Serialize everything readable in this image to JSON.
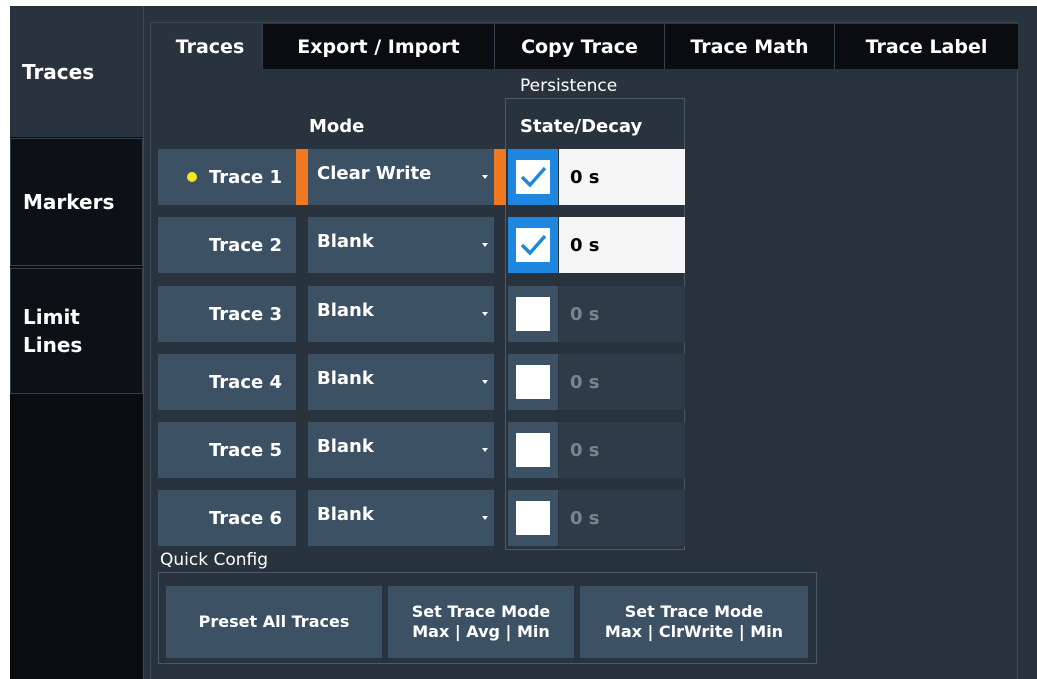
{
  "side_tabs": [
    {
      "label_lines": [
        "Traces"
      ],
      "active": true
    },
    {
      "label_lines": [
        "Markers"
      ],
      "active": false
    },
    {
      "label_lines": [
        "Limit",
        "Lines"
      ],
      "active": false
    }
  ],
  "top_tabs": [
    {
      "label": "Traces",
      "active": true
    },
    {
      "label": "Export / Import",
      "active": false
    },
    {
      "label": "Copy Trace",
      "active": false
    },
    {
      "label": "Trace Math",
      "active": false
    },
    {
      "label": "Trace Label",
      "active": false
    }
  ],
  "headers": {
    "persistence": "Persistence",
    "mode": "Mode",
    "state_decay": "State/Decay"
  },
  "traces": [
    {
      "name": "Trace 1",
      "mode": "Clear Write",
      "state": true,
      "decay": "0 s",
      "selected": true
    },
    {
      "name": "Trace 2",
      "mode": "Blank",
      "state": true,
      "decay": "0 s",
      "selected": false
    },
    {
      "name": "Trace 3",
      "mode": "Blank",
      "state": false,
      "decay": "0 s",
      "selected": false
    },
    {
      "name": "Trace 4",
      "mode": "Blank",
      "state": false,
      "decay": "0 s",
      "selected": false
    },
    {
      "name": "Trace 5",
      "mode": "Blank",
      "state": false,
      "decay": "0 s",
      "selected": false
    },
    {
      "name": "Trace 6",
      "mode": "Blank",
      "state": false,
      "decay": "0 s",
      "selected": false
    }
  ],
  "quick_config": {
    "title": "Quick Config",
    "preset_all": "Preset All Traces",
    "max_avg_min": {
      "line1": "Set Trace Mode",
      "line2": "Max | Avg | Min"
    },
    "max_clrwrite_min": {
      "line1": "Set Trace Mode",
      "line2": "Max | ClrWrite | Min"
    }
  },
  "colors": {
    "accent_orange": "#f07820",
    "checkbox_blue": "#1f87e0",
    "selected_dot": "#f0e81f",
    "button_bg": "#3c5164",
    "panel_bg": "#29333d"
  }
}
